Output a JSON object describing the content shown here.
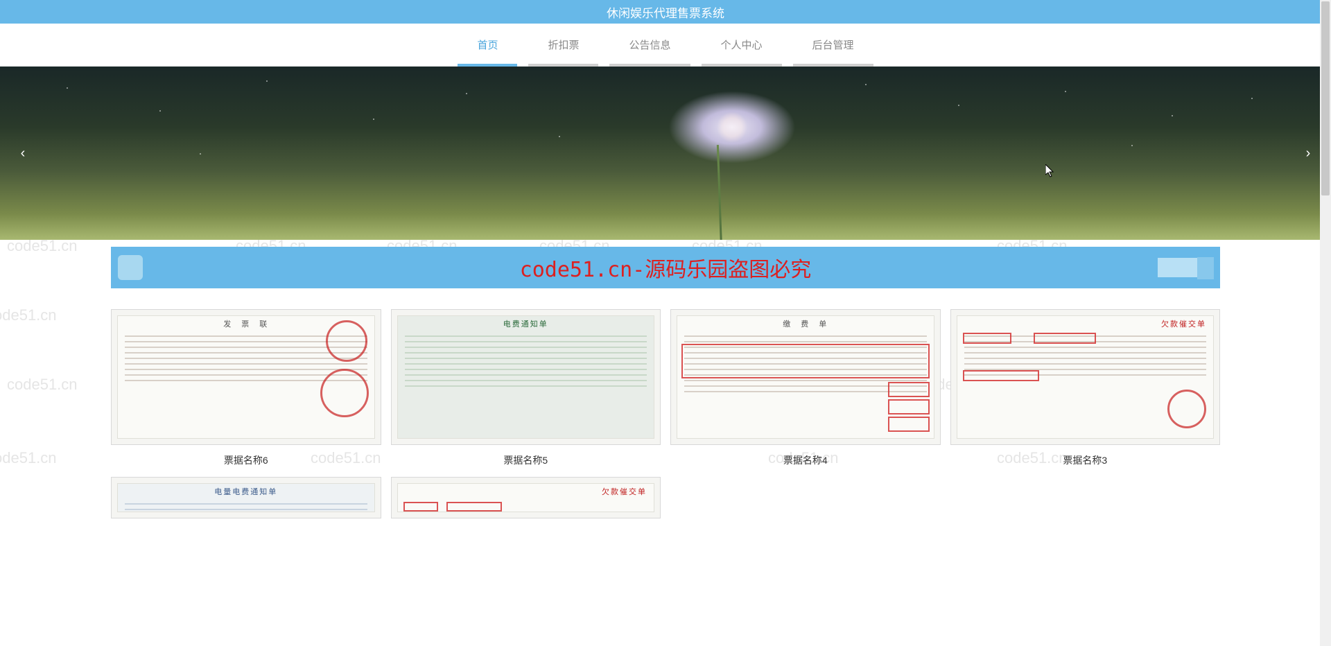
{
  "header": {
    "title": "休闲娱乐代理售票系统"
  },
  "nav": {
    "items": [
      {
        "label": "首页",
        "active": true
      },
      {
        "label": "折扣票",
        "active": false
      },
      {
        "label": "公告信息",
        "active": false
      },
      {
        "label": "个人中心",
        "active": false
      },
      {
        "label": "后台管理",
        "active": false
      }
    ]
  },
  "banner_overlay": {
    "text": "code51.cn-源码乐园盗图必究"
  },
  "watermark": {
    "text": "code51.cn"
  },
  "tickets": [
    {
      "label": "票据名称6"
    },
    {
      "label": "票据名称5"
    },
    {
      "label": "票据名称4"
    },
    {
      "label": "票据名称3"
    },
    {
      "label": ""
    },
    {
      "label": ""
    }
  ],
  "carousel": {
    "prev_icon": "‹",
    "next_icon": "›"
  }
}
